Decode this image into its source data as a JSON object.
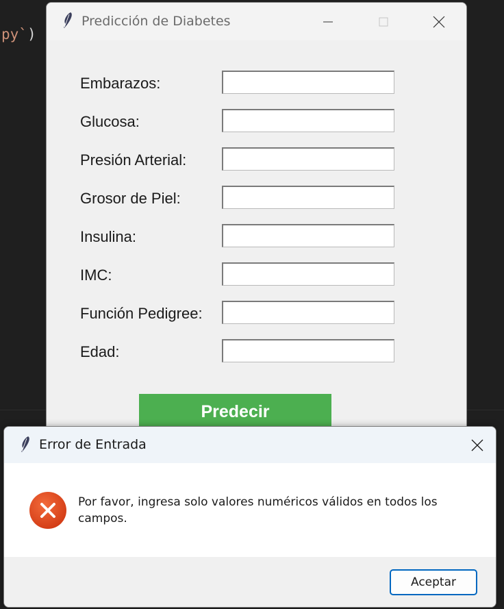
{
  "editor": {
    "code_fragment": "py`",
    "code_paren": ")"
  },
  "main_window": {
    "title": "Predicción de Diabetes",
    "fields": [
      {
        "label": "Embarazos:",
        "value": ""
      },
      {
        "label": "Glucosa:",
        "value": ""
      },
      {
        "label": "Presión Arterial:",
        "value": ""
      },
      {
        "label": "Grosor de Piel:",
        "value": ""
      },
      {
        "label": "Insulina:",
        "value": ""
      },
      {
        "label": "IMC:",
        "value": ""
      },
      {
        "label": "Función Pedigree:",
        "value": ""
      },
      {
        "label": "Edad:",
        "value": ""
      }
    ],
    "predict_label": "Predecir",
    "predict_color": "#4caf50"
  },
  "dialog": {
    "title": "Error de Entrada",
    "message": "Por favor, ingresa solo valores numéricos válidos en todos los campos.",
    "ok_label": "Aceptar",
    "icon": "error-icon",
    "icon_color": "#e0461d"
  }
}
